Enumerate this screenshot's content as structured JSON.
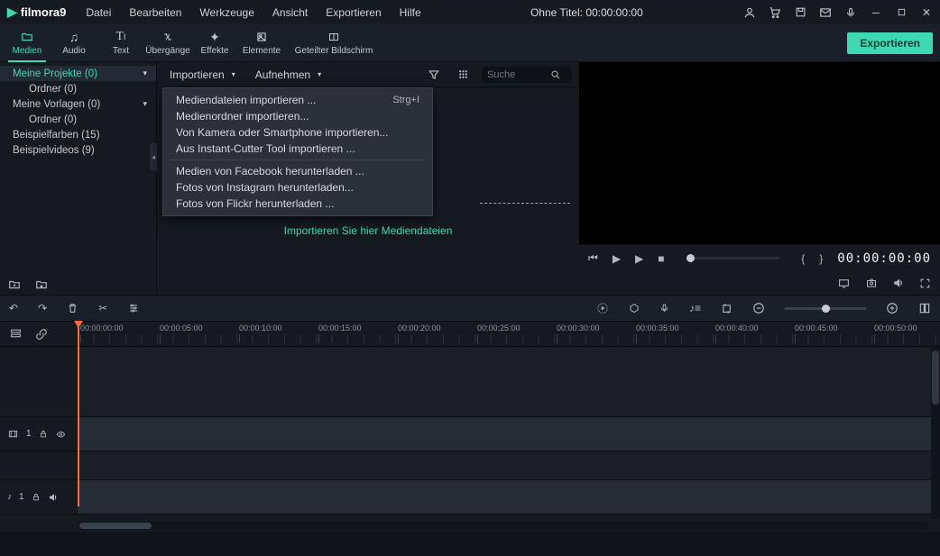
{
  "app": {
    "name": "filmora",
    "version": "9",
    "title_prefix": "Ohne Titel:",
    "title_time": "00:00:00:00"
  },
  "menu": {
    "file": "Datei",
    "edit": "Bearbeiten",
    "tools": "Werkzeuge",
    "view": "Ansicht",
    "export": "Exportieren",
    "help": "Hilfe"
  },
  "toolbar": {
    "media": "Medien",
    "audio": "Audio",
    "text": "Text",
    "transitions": "Übergänge",
    "effects": "Effekte",
    "elements": "Elemente",
    "split": "Geteilter Bildschirm",
    "export_btn": "Exportieren"
  },
  "sidebar": {
    "my_projects": "Meine Projekte (0)",
    "folder1": "Ordner (0)",
    "my_templates": "Meine Vorlagen (0)",
    "folder2": "Ordner (0)",
    "sample_colors": "Beispielfarben (15)",
    "sample_videos": "Beispielvideos (9)"
  },
  "media_panel": {
    "import_dd": "Importieren",
    "record_dd": "Aufnehmen",
    "search_placeholder": "Suche",
    "drag_hint": "Importieren Sie hier Mediendateien"
  },
  "import_menu": {
    "files": "Mediendateien importieren ...",
    "files_shortcut": "Strg+I",
    "folder": "Medienordner importieren...",
    "camera": "Von Kamera oder Smartphone importieren...",
    "instant": "Aus Instant-Cutter Tool importieren ...",
    "facebook": "Medien von Facebook herunterladen ...",
    "instagram": "Fotos von Instagram herunterladen...",
    "flickr": "Fotos von Flickr herunterladen ..."
  },
  "preview": {
    "timecode": "00:00:00:00"
  },
  "timeline": {
    "ticks": [
      "00:00:00:00",
      "00:00:05:00",
      "00:00:10:00",
      "00:00:15:00",
      "00:00:20:00",
      "00:00:25:00",
      "00:00:30:00",
      "00:00:35:00",
      "00:00:40:00",
      "00:00:45:00",
      "00:00:50:00"
    ],
    "video_track_index": "1",
    "audio_track_index": "1"
  }
}
